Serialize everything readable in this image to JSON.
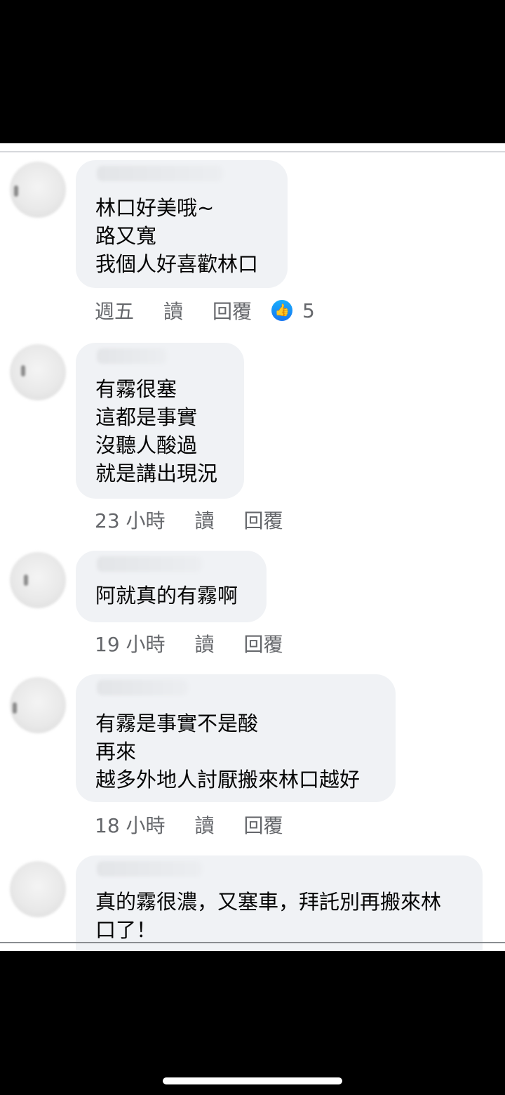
{
  "comments": [
    {
      "lines": [
        "林口好美哦~",
        "路又寬",
        "我個人好喜歡林口"
      ],
      "time": "週五",
      "like": "讀",
      "reply": "回覆",
      "reaction_count": "5"
    },
    {
      "lines": [
        "有霧很塞",
        "這都是事實",
        "沒聽人酸過",
        "就是講出現況"
      ],
      "time": "23 小時",
      "like": "讀",
      "reply": "回覆"
    },
    {
      "lines": [
        "阿就真的有霧啊"
      ],
      "time": "19 小時",
      "like": "讀",
      "reply": "回覆"
    },
    {
      "lines": [
        "有霧是事實不是酸",
        "再來",
        "越多外地人討厭搬來林口越好"
      ],
      "time": "18 小時",
      "like": "讀",
      "reply": "回覆"
    },
    {
      "lines": [
        "真的霧很濃，又塞車，拜託別再搬來林",
        "口了！"
      ]
    }
  ],
  "colors": {
    "bubble": "#f0f2f5",
    "meta_text": "#65676b",
    "like_blue": "#1877f2"
  },
  "icons": {
    "reaction": "like-thumb-icon"
  }
}
